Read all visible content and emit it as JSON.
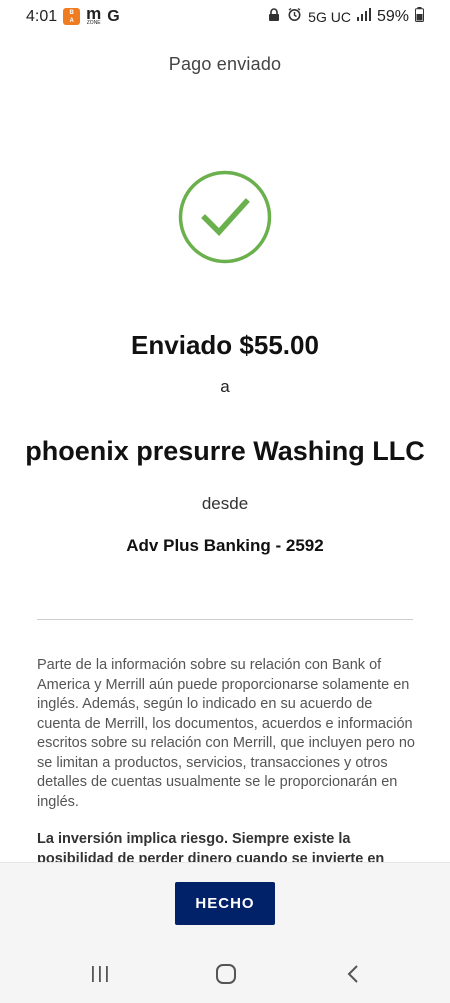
{
  "status_bar": {
    "time": "4:01",
    "app_badge_text": "BOA\nBOA",
    "m_icon_letter": "m",
    "m_icon_sub": "ZONE",
    "g_icon_letter": "G",
    "network": "5G UC",
    "battery": "59%"
  },
  "header": {
    "title": "Pago enviado"
  },
  "confirmation": {
    "sent_amount": "Enviado $55.00",
    "to_word": "a",
    "payee": "phoenix presurre Washing LLC",
    "from_word": "desde",
    "account": "Adv Plus Banking - 2592",
    "check_color": "#6ab04c"
  },
  "disclaimer": {
    "text": "Parte de la información sobre su relación con Bank of America y Merrill aún puede proporcionarse solamente en inglés. Además, según lo indicado en su acuerdo de cuenta de Merrill, los documentos, acuerdos e información escritos sobre su relación con Merrill, que incluyen pero no se limitan a productos, servicios, transacciones y otros detalles de cuentas usualmente se le proporcionarán en inglés.",
    "risk_text": "La inversión implica riesgo. Siempre existe la posibilidad de perder dinero cuando se invierte en"
  },
  "actions": {
    "done_label": "HECHO",
    "done_color": "#012169"
  },
  "nav": {
    "recents_icon": "recents-icon",
    "home_icon": "home-icon",
    "back_icon": "back-icon"
  }
}
